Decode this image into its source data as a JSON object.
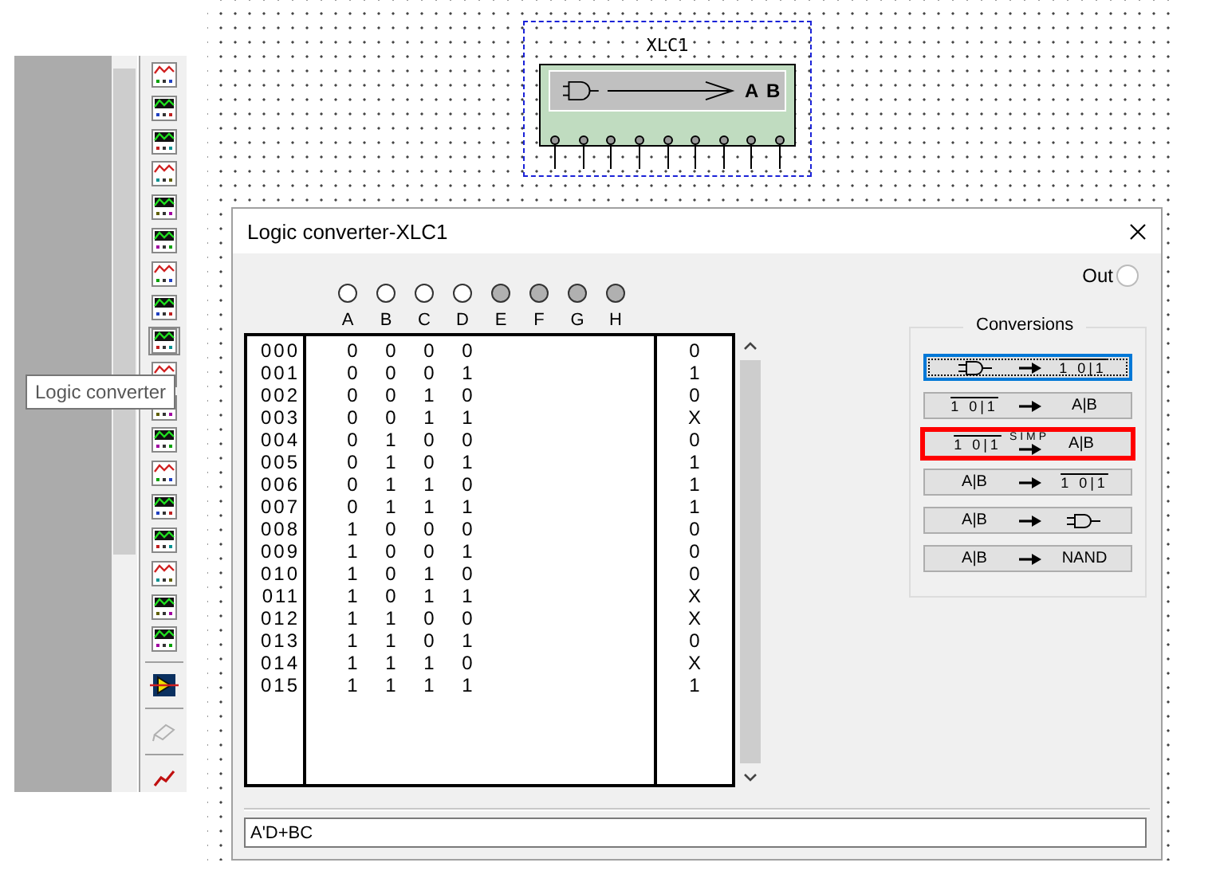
{
  "toolbar": {
    "items": [
      {
        "kind": "instrument",
        "selected": false
      },
      {
        "kind": "instrument",
        "selected": false
      },
      {
        "kind": "instrument",
        "selected": false
      },
      {
        "kind": "instrument",
        "selected": false
      },
      {
        "kind": "instrument",
        "selected": false
      },
      {
        "kind": "instrument",
        "selected": false
      },
      {
        "kind": "instrument",
        "selected": false
      },
      {
        "kind": "instrument",
        "selected": false
      },
      {
        "kind": "instrument",
        "selected": true
      },
      {
        "kind": "instrument",
        "selected": false
      },
      {
        "kind": "instrument",
        "selected": false
      },
      {
        "kind": "instrument",
        "selected": false
      },
      {
        "kind": "instrument",
        "selected": false
      },
      {
        "kind": "instrument",
        "selected": false
      },
      {
        "kind": "instrument",
        "selected": false
      },
      {
        "kind": "instrument",
        "selected": false
      },
      {
        "kind": "instrument",
        "selected": false
      },
      {
        "kind": "instrument",
        "selected": false
      },
      {
        "kind": "separator"
      },
      {
        "kind": "amplifier",
        "selected": false
      },
      {
        "kind": "separator"
      },
      {
        "kind": "disabled",
        "selected": false
      },
      {
        "kind": "separator"
      },
      {
        "kind": "probe",
        "selected": false
      }
    ]
  },
  "tooltip": {
    "text": "Logic converter"
  },
  "component": {
    "label": "XLC1",
    "body_text": "A B"
  },
  "dialog": {
    "title": "Logic converter-XLC1",
    "terminals": [
      {
        "label": "A",
        "active": true
      },
      {
        "label": "B",
        "active": true
      },
      {
        "label": "C",
        "active": true
      },
      {
        "label": "D",
        "active": true
      },
      {
        "label": "E",
        "active": false
      },
      {
        "label": "F",
        "active": false
      },
      {
        "label": "G",
        "active": false
      },
      {
        "label": "H",
        "active": false
      }
    ],
    "out_label": "Out",
    "table": {
      "rows": [
        {
          "index": "000",
          "inputs": [
            "0",
            "0",
            "0",
            "0"
          ],
          "output": "0"
        },
        {
          "index": "001",
          "inputs": [
            "0",
            "0",
            "0",
            "1"
          ],
          "output": "1"
        },
        {
          "index": "002",
          "inputs": [
            "0",
            "0",
            "1",
            "0"
          ],
          "output": "0"
        },
        {
          "index": "003",
          "inputs": [
            "0",
            "0",
            "1",
            "1"
          ],
          "output": "X"
        },
        {
          "index": "004",
          "inputs": [
            "0",
            "1",
            "0",
            "0"
          ],
          "output": "0"
        },
        {
          "index": "005",
          "inputs": [
            "0",
            "1",
            "0",
            "1"
          ],
          "output": "1"
        },
        {
          "index": "006",
          "inputs": [
            "0",
            "1",
            "1",
            "0"
          ],
          "output": "1"
        },
        {
          "index": "007",
          "inputs": [
            "0",
            "1",
            "1",
            "1"
          ],
          "output": "1"
        },
        {
          "index": "008",
          "inputs": [
            "1",
            "0",
            "0",
            "0"
          ],
          "output": "0"
        },
        {
          "index": "009",
          "inputs": [
            "1",
            "0",
            "0",
            "1"
          ],
          "output": "0"
        },
        {
          "index": "010",
          "inputs": [
            "1",
            "0",
            "1",
            "0"
          ],
          "output": "0"
        },
        {
          "index": "011",
          "inputs": [
            "1",
            "0",
            "1",
            "1"
          ],
          "output": "X"
        },
        {
          "index": "012",
          "inputs": [
            "1",
            "1",
            "0",
            "0"
          ],
          "output": "X"
        },
        {
          "index": "013",
          "inputs": [
            "1",
            "1",
            "0",
            "1"
          ],
          "output": "0"
        },
        {
          "index": "014",
          "inputs": [
            "1",
            "1",
            "1",
            "0"
          ],
          "output": "X"
        },
        {
          "index": "015",
          "inputs": [
            "1",
            "1",
            "1",
            "1"
          ],
          "output": "1"
        }
      ]
    },
    "conversions": {
      "title": "Conversions",
      "buttons": [
        {
          "focused": true,
          "highlighted": false,
          "from": {
            "kind": "gate"
          },
          "to": {
            "kind": "table",
            "text": "1 0|1"
          }
        },
        {
          "focused": false,
          "highlighted": false,
          "from": {
            "kind": "table",
            "text": "1 0|1"
          },
          "to": {
            "kind": "text",
            "text": "A|B"
          }
        },
        {
          "focused": false,
          "highlighted": true,
          "from": {
            "kind": "table",
            "text": "1 0|1"
          },
          "arrow_label": "SIMP",
          "to": {
            "kind": "text",
            "text": "A|B"
          }
        },
        {
          "focused": false,
          "highlighted": false,
          "from": {
            "kind": "text",
            "text": "A|B"
          },
          "to": {
            "kind": "table",
            "text": "1 0|1"
          }
        },
        {
          "focused": false,
          "highlighted": false,
          "from": {
            "kind": "text",
            "text": "A|B"
          },
          "to": {
            "kind": "gate"
          }
        },
        {
          "focused": false,
          "highlighted": false,
          "from": {
            "kind": "text",
            "text": "A|B"
          },
          "to": {
            "kind": "text",
            "text": "NAND"
          }
        }
      ]
    },
    "expression": {
      "value": "A'D+BC"
    }
  }
}
